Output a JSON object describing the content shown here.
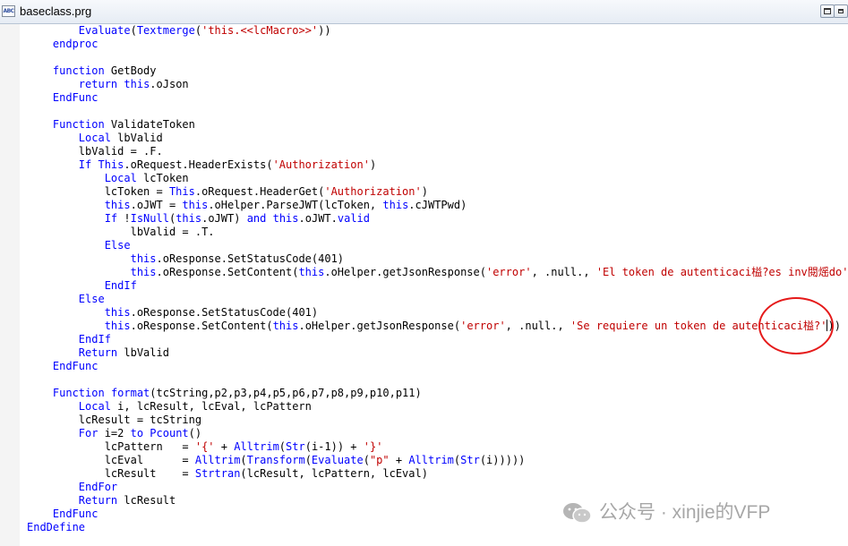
{
  "window": {
    "title": "baseclass.prg",
    "app_icon_text": "ABC",
    "app_icon": "text-file-icon",
    "buttons": [
      "restore-icon"
    ]
  },
  "code_lines": [
    [
      [
        "        ",
        ""
      ],
      [
        "Evaluate",
        "kw"
      ],
      [
        "(",
        ""
      ],
      [
        "Textmerge",
        "kw"
      ],
      [
        "(",
        ""
      ],
      [
        "'this.<<lcMacro>>'",
        "str"
      ],
      [
        "))",
        ""
      ]
    ],
    [
      [
        "    ",
        ""
      ],
      [
        "endproc",
        "kw"
      ]
    ],
    [],
    [
      [
        "    ",
        ""
      ],
      [
        "function",
        "kw"
      ],
      [
        " GetBody",
        ""
      ]
    ],
    [
      [
        "        ",
        ""
      ],
      [
        "return",
        "kw"
      ],
      [
        " ",
        ""
      ],
      [
        "this",
        "kw"
      ],
      [
        ".oJson",
        ""
      ]
    ],
    [
      [
        "    ",
        ""
      ],
      [
        "EndFunc",
        "kw"
      ]
    ],
    [],
    [
      [
        "    ",
        ""
      ],
      [
        "Function",
        "kw"
      ],
      [
        " ValidateToken",
        ""
      ]
    ],
    [
      [
        "        ",
        ""
      ],
      [
        "Local",
        "kw"
      ],
      [
        " lbValid",
        ""
      ]
    ],
    [
      [
        "        lbValid = .F.",
        ""
      ]
    ],
    [
      [
        "        ",
        ""
      ],
      [
        "If",
        "kw"
      ],
      [
        " ",
        ""
      ],
      [
        "This",
        "kw"
      ],
      [
        ".oRequest.HeaderExists(",
        ""
      ],
      [
        "'Authorization'",
        "str"
      ],
      [
        ")",
        ""
      ]
    ],
    [
      [
        "            ",
        ""
      ],
      [
        "Local",
        "kw"
      ],
      [
        " lcToken",
        ""
      ]
    ],
    [
      [
        "            lcToken = ",
        ""
      ],
      [
        "This",
        "kw"
      ],
      [
        ".oRequest.HeaderGet(",
        ""
      ],
      [
        "'Authorization'",
        "str"
      ],
      [
        ")",
        ""
      ]
    ],
    [
      [
        "            ",
        ""
      ],
      [
        "this",
        "kw"
      ],
      [
        ".oJWT = ",
        ""
      ],
      [
        "this",
        "kw"
      ],
      [
        ".oHelper.ParseJWT(lcToken, ",
        ""
      ],
      [
        "this",
        "kw"
      ],
      [
        ".cJWTPwd)",
        ""
      ]
    ],
    [
      [
        "            ",
        ""
      ],
      [
        "If",
        "kw"
      ],
      [
        " !",
        ""
      ],
      [
        "IsNull",
        "kw"
      ],
      [
        "(",
        ""
      ],
      [
        "this",
        "kw"
      ],
      [
        ".oJWT) ",
        ""
      ],
      [
        "and",
        "kw"
      ],
      [
        " ",
        ""
      ],
      [
        "this",
        "kw"
      ],
      [
        ".oJWT.",
        ""
      ],
      [
        "valid",
        "kw"
      ]
    ],
    [
      [
        "                lbValid = .T.",
        ""
      ]
    ],
    [
      [
        "            ",
        ""
      ],
      [
        "Else",
        "kw"
      ]
    ],
    [
      [
        "                ",
        ""
      ],
      [
        "this",
        "kw"
      ],
      [
        ".oResponse.SetStatusCode(401)",
        ""
      ]
    ],
    [
      [
        "                ",
        ""
      ],
      [
        "this",
        "kw"
      ],
      [
        ".oResponse.SetContent(",
        ""
      ],
      [
        "this",
        "kw"
      ],
      [
        ".oHelper.getJsonResponse(",
        ""
      ],
      [
        "'error'",
        "str"
      ],
      [
        ", .null., ",
        ""
      ],
      [
        "'El token de autenticaci榏?es inv閱熎do'",
        "str"
      ],
      [
        "))",
        ""
      ]
    ],
    [
      [
        "            ",
        ""
      ],
      [
        "EndIf",
        "kw"
      ]
    ],
    [
      [
        "        ",
        ""
      ],
      [
        "Else",
        "kw"
      ]
    ],
    [
      [
        "            ",
        ""
      ],
      [
        "this",
        "kw"
      ],
      [
        ".oResponse.SetStatusCode(401)",
        ""
      ]
    ],
    [
      [
        "            ",
        ""
      ],
      [
        "this",
        "kw"
      ],
      [
        ".oResponse.SetContent(",
        ""
      ],
      [
        "this",
        "kw"
      ],
      [
        ".oHelper.getJsonResponse(",
        ""
      ],
      [
        "'error'",
        "str"
      ],
      [
        ", .null., ",
        ""
      ],
      [
        "'Se requiere un token de autenticaci榏?'",
        "str"
      ],
      [
        "|",
        "cursor"
      ],
      [
        "))",
        ""
      ]
    ],
    [
      [
        "        ",
        ""
      ],
      [
        "EndIf",
        "kw"
      ]
    ],
    [
      [
        "        ",
        ""
      ],
      [
        "Return",
        "kw"
      ],
      [
        " lbValid",
        ""
      ]
    ],
    [
      [
        "    ",
        ""
      ],
      [
        "EndFunc",
        "kw"
      ]
    ],
    [],
    [
      [
        "    ",
        ""
      ],
      [
        "Function",
        "kw"
      ],
      [
        " ",
        ""
      ],
      [
        "format",
        "kw"
      ],
      [
        "(tcString,p2,p3,p4,p5,p6,p7,p8,p9,p10,p11)",
        ""
      ]
    ],
    [
      [
        "        ",
        ""
      ],
      [
        "Local",
        "kw"
      ],
      [
        " i, lcResult, lcEval, lcPattern",
        ""
      ]
    ],
    [
      [
        "        lcResult = tcString",
        ""
      ]
    ],
    [
      [
        "        ",
        ""
      ],
      [
        "For",
        "kw"
      ],
      [
        " i=2 ",
        ""
      ],
      [
        "to",
        "kw"
      ],
      [
        " ",
        ""
      ],
      [
        "Pcount",
        "kw"
      ],
      [
        "()",
        ""
      ]
    ],
    [
      [
        "            lcPattern   = ",
        ""
      ],
      [
        "'{'",
        "str"
      ],
      [
        " + ",
        ""
      ],
      [
        "Alltrim",
        "kw"
      ],
      [
        "(",
        ""
      ],
      [
        "Str",
        "kw"
      ],
      [
        "(i-1)) + ",
        ""
      ],
      [
        "'}'",
        "str"
      ]
    ],
    [
      [
        "            lcEval      = ",
        ""
      ],
      [
        "Alltrim",
        "kw"
      ],
      [
        "(",
        ""
      ],
      [
        "Transform",
        "kw"
      ],
      [
        "(",
        ""
      ],
      [
        "Evaluate",
        "kw"
      ],
      [
        "(",
        ""
      ],
      [
        "\"p\"",
        "str"
      ],
      [
        " + ",
        ""
      ],
      [
        "Alltrim",
        "kw"
      ],
      [
        "(",
        ""
      ],
      [
        "Str",
        "kw"
      ],
      [
        "(i)))))",
        ""
      ]
    ],
    [
      [
        "            lcResult    = ",
        ""
      ],
      [
        "Strtran",
        "kw"
      ],
      [
        "(lcResult, lcPattern, lcEval)",
        ""
      ]
    ],
    [
      [
        "        ",
        ""
      ],
      [
        "EndFor",
        "kw"
      ]
    ],
    [
      [
        "        ",
        ""
      ],
      [
        "Return",
        "kw"
      ],
      [
        " lcResult",
        ""
      ]
    ],
    [
      [
        "    ",
        ""
      ],
      [
        "EndFunc",
        "kw"
      ]
    ],
    [
      [
        "EndDefine",
        "kw"
      ]
    ]
  ],
  "watermark": {
    "text": "公众号 · xinjie的VFP",
    "icon": "wechat-logo-icon"
  },
  "annotation": {
    "kind": "red-circle-highlight"
  }
}
